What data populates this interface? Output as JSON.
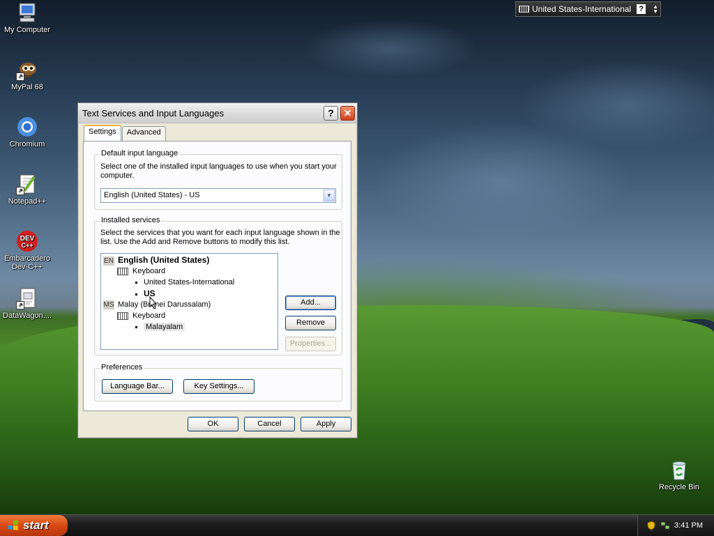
{
  "desktop": {
    "icons": [
      {
        "label": "My Computer"
      },
      {
        "label": "MyPal 68"
      },
      {
        "label": "Chromium"
      },
      {
        "label": "Notepad++"
      },
      {
        "label": "Embarcadero Dev-C++"
      },
      {
        "label": "DataWagon...."
      },
      {
        "label": "Recycle Bin"
      }
    ]
  },
  "language_bar": {
    "label": "United States-International",
    "help": "?"
  },
  "dialog": {
    "title": "Text Services and Input Languages",
    "help_button": "?",
    "close_button": "✕",
    "tabs": [
      {
        "label": "Settings",
        "active": true
      },
      {
        "label": "Advanced",
        "active": false
      }
    ],
    "default_input": {
      "legend": "Default input language",
      "description": "Select one of the installed input languages to use when you start your computer.",
      "selected": "English (United States) - US"
    },
    "installed": {
      "legend": "Installed services",
      "description": "Select the services that you want for each input language shown in the list. Use the Add and Remove buttons to modify this list.",
      "tree": [
        {
          "code": "EN",
          "language": "English (United States)",
          "category": "Keyboard",
          "layouts": [
            "United States-International",
            "US"
          ]
        },
        {
          "code": "MS",
          "language": "Malay (Brunei Darussalam)",
          "category": "Keyboard",
          "layouts": [
            "Malayalam"
          ]
        }
      ],
      "buttons": {
        "add": "Add...",
        "remove": "Remove",
        "properties": "Properties..."
      }
    },
    "preferences": {
      "legend": "Preferences",
      "language_bar": "Language Bar...",
      "key_settings": "Key Settings..."
    },
    "footer": {
      "ok": "OK",
      "cancel": "Cancel",
      "apply": "Apply"
    }
  },
  "taskbar": {
    "start": "start",
    "clock": "3:41 PM"
  }
}
